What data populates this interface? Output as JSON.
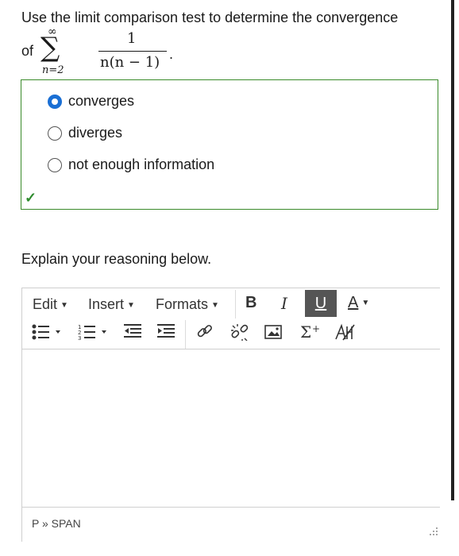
{
  "question": {
    "text": "Use the limit comparison test to determine the convergence",
    "of": "of",
    "sum_upper": "∞",
    "sum_lower": "n=2",
    "numerator": "1",
    "denominator": "n(n − 1)",
    "period": "."
  },
  "choices": {
    "options": [
      {
        "label": "converges",
        "selected": true
      },
      {
        "label": "diverges",
        "selected": false
      },
      {
        "label": "not enough information",
        "selected": false
      }
    ],
    "correct_mark": "✓",
    "border_color": "#3a8a2a",
    "selected_color": "#1a6fd4"
  },
  "explain": {
    "label": "Explain your reasoning below."
  },
  "editor": {
    "menus": [
      "Edit",
      "Insert",
      "Formats"
    ],
    "bold": "B",
    "italic": "I",
    "underline": "U",
    "text_color": "A",
    "status_path": "P » SPAN"
  }
}
